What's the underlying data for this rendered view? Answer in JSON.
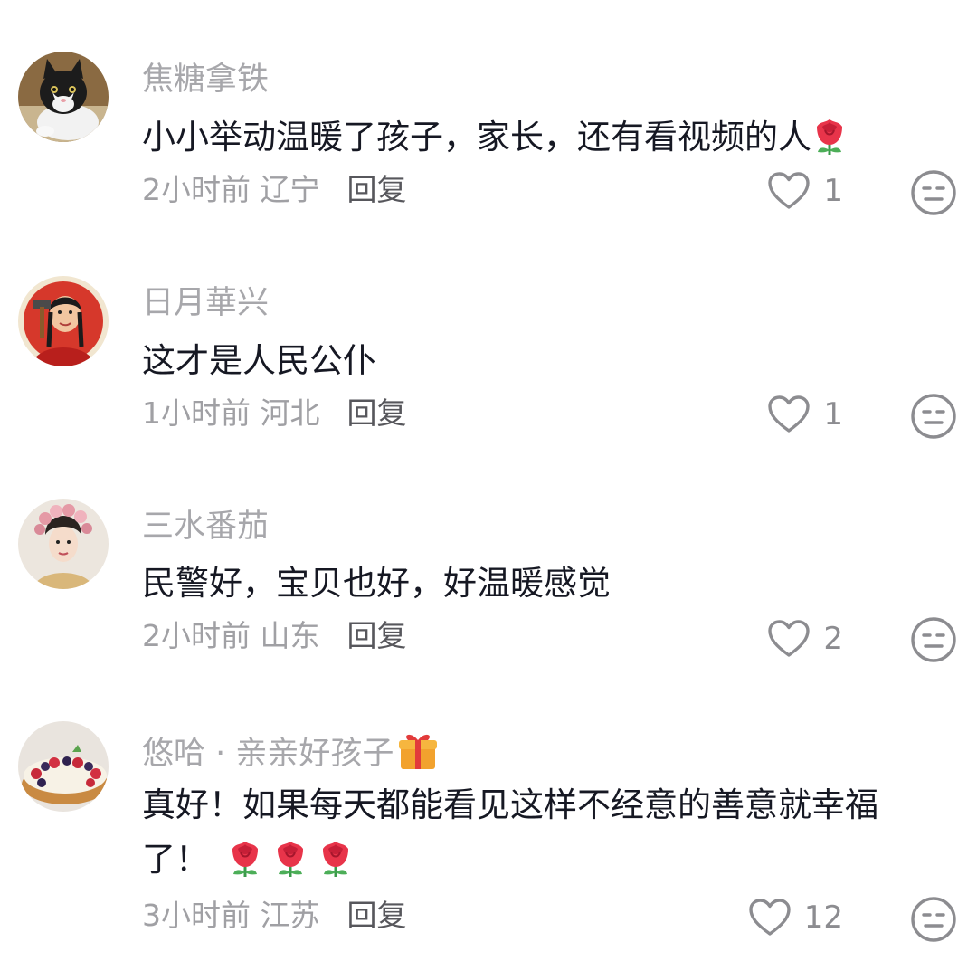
{
  "comments": [
    {
      "username": "焦糖拿铁",
      "text": "小小举动温暖了孩子，家长，还有看视频的人",
      "text_emojis": [
        "rose-emoji"
      ],
      "time": "2小时前",
      "location": "辽宁",
      "reply_label": "回复",
      "likes": "1",
      "avatar": "cat-avatar"
    },
    {
      "username": "日月華兴",
      "text": "这才是人民公仆",
      "time": "1小时前",
      "location": "河北",
      "reply_label": "回复",
      "likes": "1",
      "avatar": "worker-woman-avatar"
    },
    {
      "username": "三水番茄",
      "text": "民警好，宝贝也好，好温暖感觉",
      "time": "2小时前",
      "location": "山东",
      "reply_label": "回复",
      "likes": "2",
      "avatar": "woman-headdress-avatar"
    },
    {
      "username": "悠哈 · 亲亲好孩子",
      "username_emoji": "gift-emoji",
      "text_line1": "真好！如果每天都能看见这样不经意的善意就幸福",
      "text_line2": "了！",
      "text_emojis": [
        "rose-emoji",
        "rose-emoji",
        "rose-emoji"
      ],
      "time": "3小时前",
      "location": "江苏",
      "reply_label": "回复",
      "likes": "12",
      "avatar": "fruit-tart-avatar"
    }
  ],
  "icons": {
    "like": "heart-outline-icon",
    "dislike": "meh-face-icon"
  },
  "colors": {
    "username": "#a7a7ab",
    "text": "#161823",
    "meta": "#a0a0a4",
    "reply": "#57575c",
    "rose": "#e8344a"
  }
}
